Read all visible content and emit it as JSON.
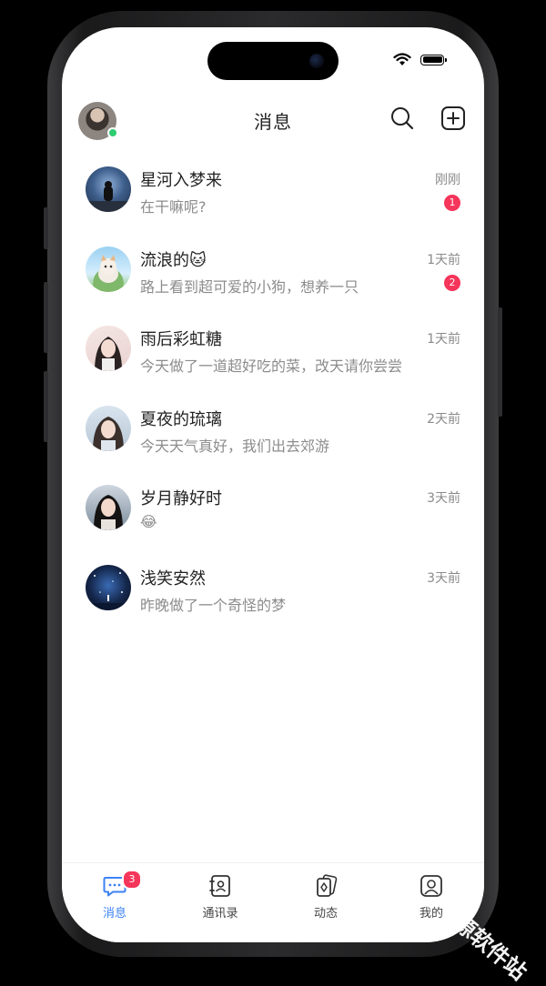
{
  "header": {
    "title": "消息"
  },
  "chats": [
    {
      "name": "星河入梦来",
      "preview": "在干嘛呢?",
      "time": "刚刚",
      "unread": "1"
    },
    {
      "name": "流浪的🐱",
      "preview": "路上看到超可爱的小狗，想养一只",
      "time": "1天前",
      "unread": "2"
    },
    {
      "name": "雨后彩虹糖",
      "preview": "今天做了一道超好吃的菜，改天请你尝尝",
      "time": "1天前",
      "unread": ""
    },
    {
      "name": "夏夜的琉璃",
      "preview": "今天天气真好，我们出去郊游",
      "time": "2天前",
      "unread": ""
    },
    {
      "name": "岁月静好时",
      "preview": "😂",
      "time": "3天前",
      "unread": ""
    },
    {
      "name": "浅笑安然",
      "preview": "昨晚做了一个奇怪的梦",
      "time": "3天前",
      "unread": ""
    }
  ],
  "tabs": [
    {
      "label": "消息",
      "badge": "3"
    },
    {
      "label": "通讯录"
    },
    {
      "label": "动态"
    },
    {
      "label": "我的"
    }
  ],
  "colors": {
    "accent": "#3b82f6",
    "badge": "#f5355a",
    "online": "#2ecc71"
  },
  "watermark": "千源软件站"
}
